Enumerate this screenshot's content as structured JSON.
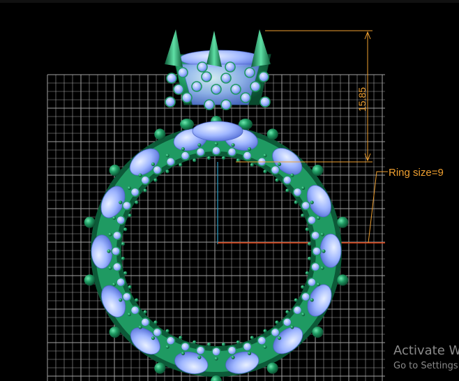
{
  "viewport": {
    "background": "#000000",
    "grid_color": "#d9d9d9",
    "ring_metal_color": "#1a8a5a",
    "gem_color": "#9fb6ff"
  },
  "annotations": {
    "height_dimension": "15.85",
    "ring_size_label": "Ring size=9",
    "dimension_color": "#f0a030",
    "center_axis_color": "#2aa0c8",
    "radius_line_color": "#e04010"
  },
  "watermark": {
    "title": "Activate W",
    "subtitle": "Go to Settings"
  }
}
